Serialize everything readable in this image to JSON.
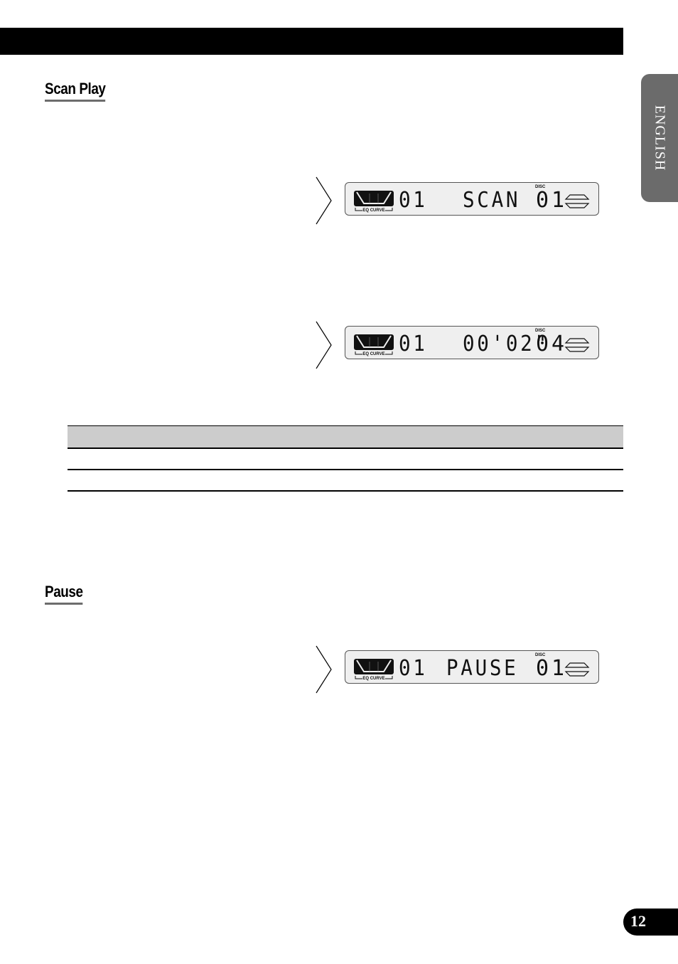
{
  "header": {
    "bar": "black-header-bar"
  },
  "language_tab": {
    "label": "ENGLISH"
  },
  "sections": [
    {
      "title": "Scan Play"
    },
    {
      "title": "Pause"
    }
  ],
  "displays": [
    {
      "eq_label": "EQ CURVE",
      "track": "01",
      "main": "SCAN",
      "disc_label": "DISC",
      "disc": "01"
    },
    {
      "eq_label": "EQ CURVE",
      "track": "01",
      "main": "00'02\"",
      "disc_label": "DISC",
      "disc": "04"
    },
    {
      "eq_label": "EQ CURVE",
      "track": "01",
      "main": "PAUSE",
      "disc_label": "DISC",
      "disc": "01"
    }
  ],
  "table": {
    "header": [
      ""
    ],
    "rows": [
      [
        ""
      ],
      [
        ""
      ]
    ]
  },
  "page": {
    "number": "12"
  }
}
